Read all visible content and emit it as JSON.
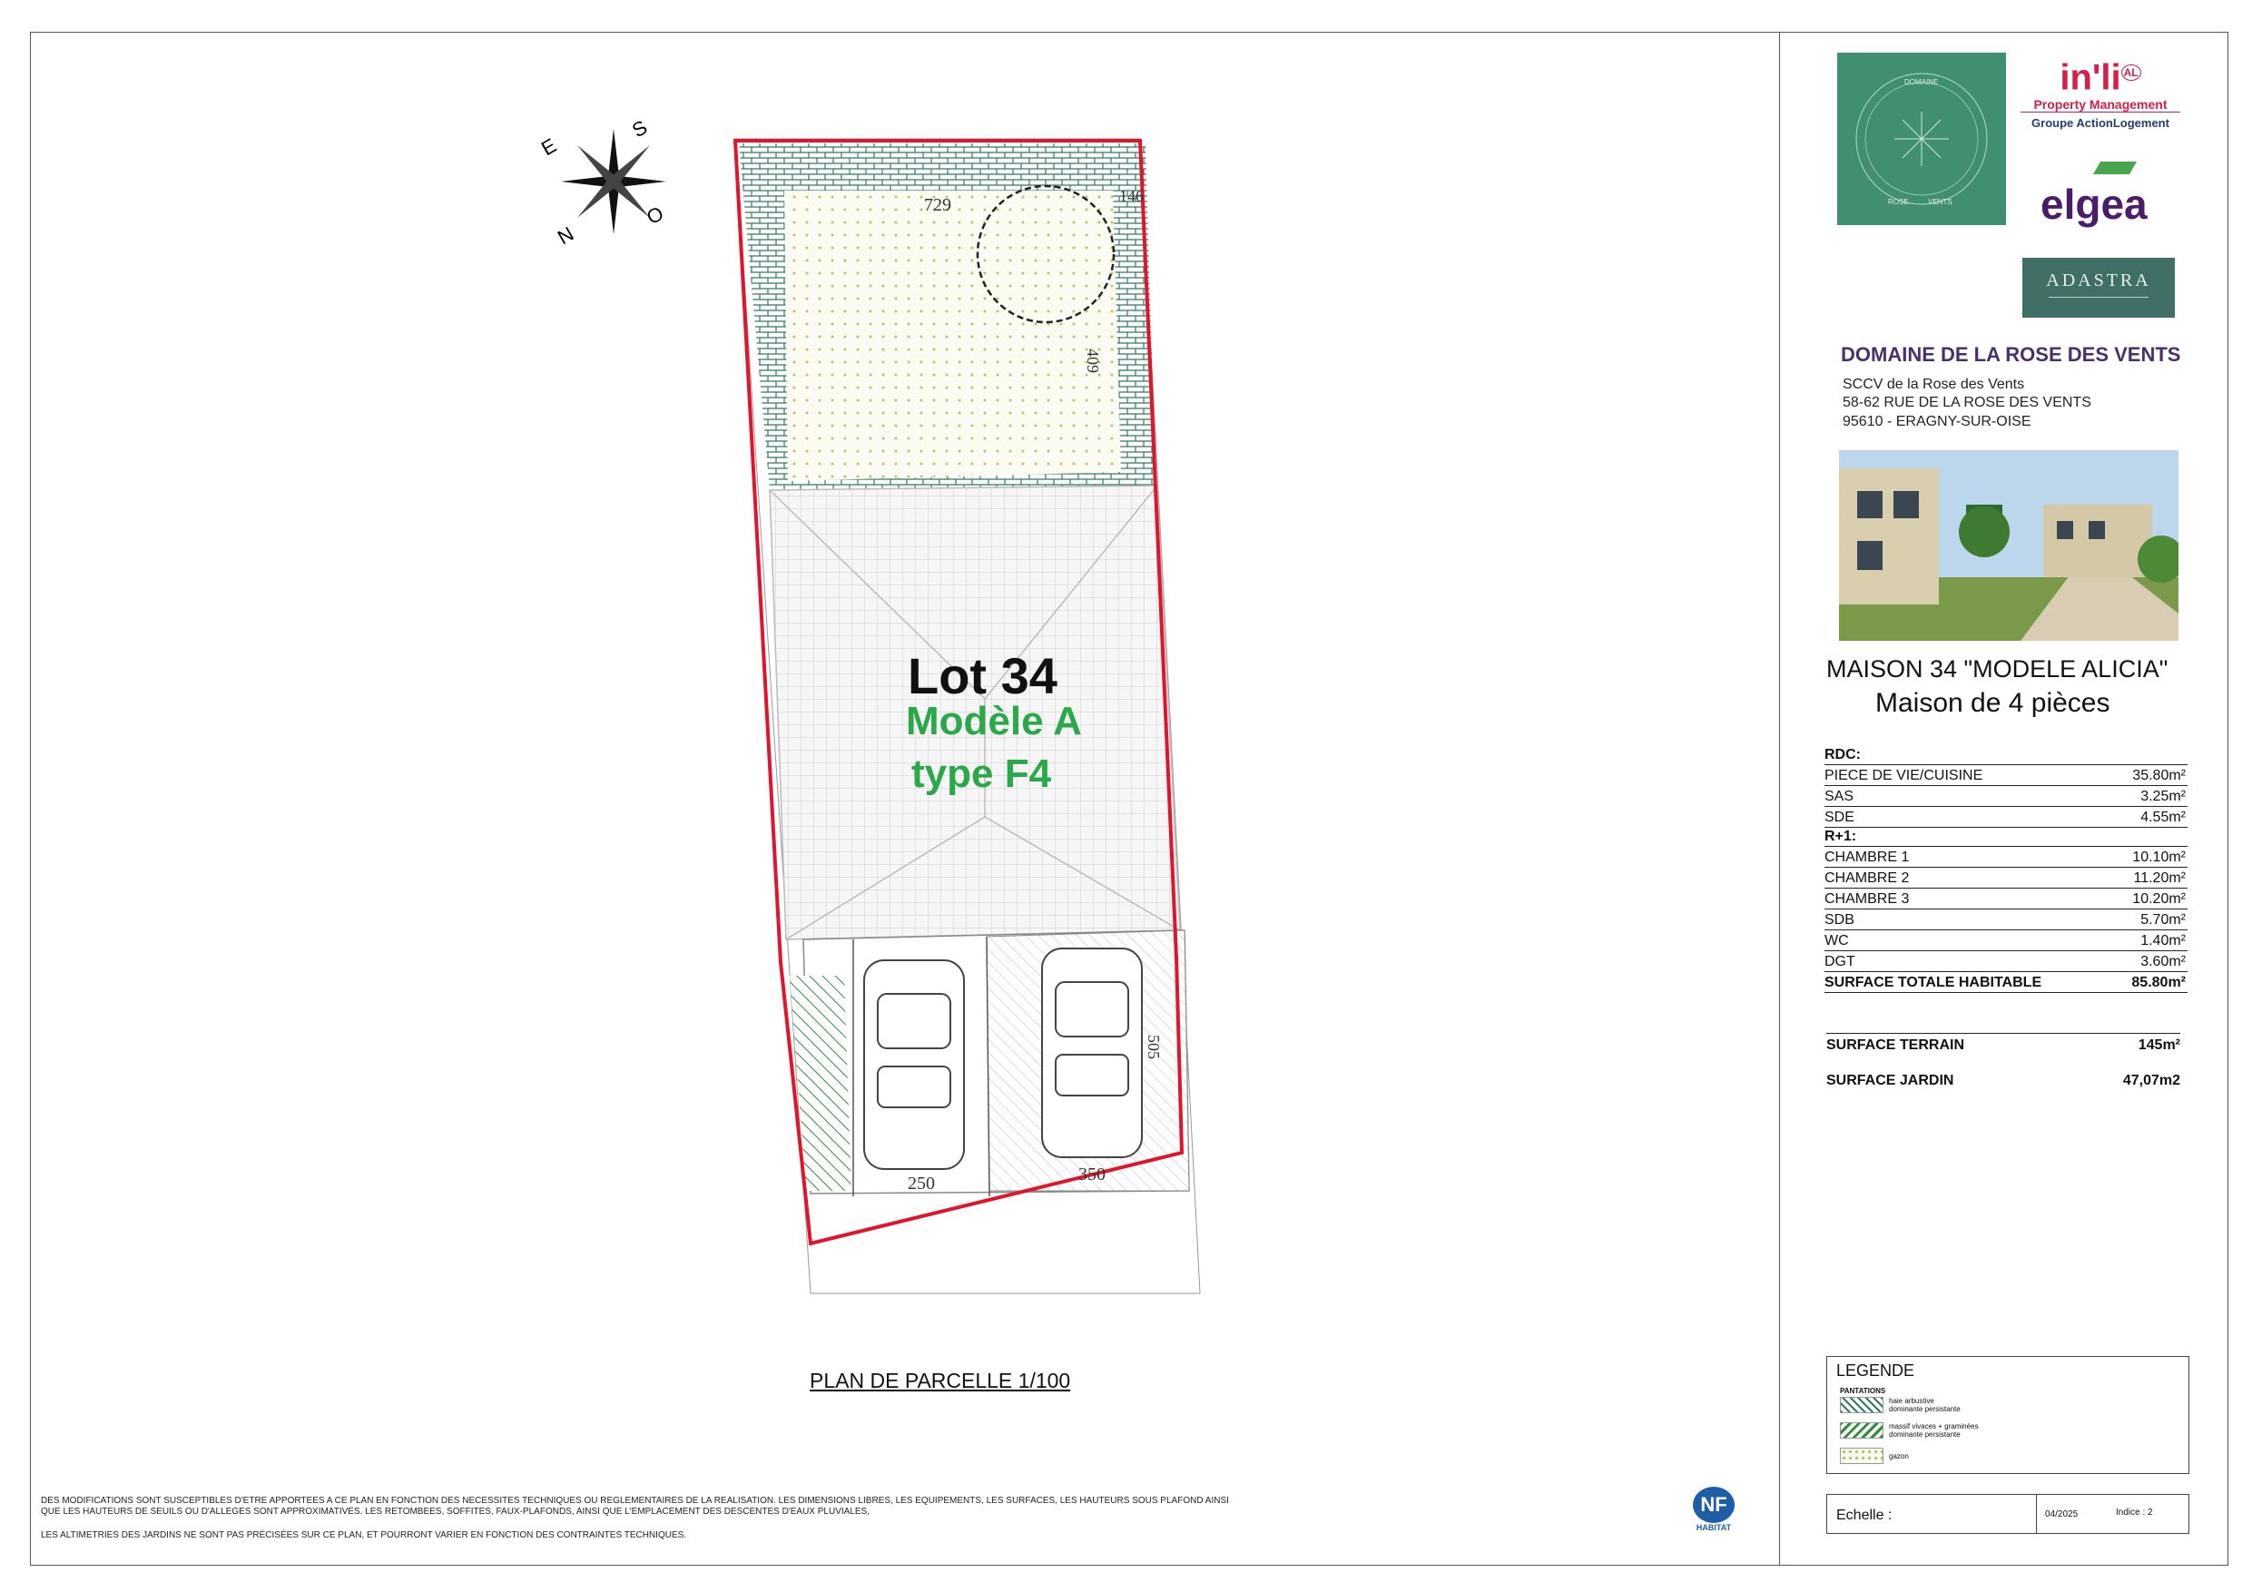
{
  "plan": {
    "lot_title": "Lot 34",
    "model": "Modèle A",
    "type": "type F4",
    "caption": "PLAN DE PARCELLE 1/100",
    "dim_top": "729",
    "dim_corner": "146",
    "dim_right": "409",
    "dim_parking_side": "505",
    "dim_park1": "250",
    "dim_park2": "350"
  },
  "compass": {
    "e": "E",
    "s": "S",
    "o": "O",
    "n": "N"
  },
  "disclaimer": {
    "line1": "DES MODIFICATIONS SONT SUSCEPTIBLES D'ETRE APPORTEES A CE PLAN EN FONCTION DES NECESSITES TECHNIQUES OU REGLEMENTAIRES DE LA REALISATION. LES DIMENSIONS LIBRES, LES EQUIPEMENTS, LES SURFACES, LES HAUTEURS SOUS PLAFOND AINSI",
    "line2": "QUE LES HAUTEURS DE SEUILS OU D'ALLEGES SONT APPROXIMATIVES. LES RETOMBEES, SOFFITES, FAUX-PLAFONDS, AINSI QUE L'EMPLACEMENT DES DESCENTES D'EAUX PLUVIALES,",
    "line3": "LES ALTIMETRIES DES JARDINS NE SONT PAS PRÉCISÉES SUR CE PLAN, ET POURRONT VARIER EN FONCTION DES CONTRAINTES TECHNIQUES."
  },
  "logos": {
    "domaine": "DOMAINE",
    "rose": "ROSE",
    "vents": "VENTS",
    "inli": "in'li",
    "inli_al": "AL",
    "inli_sub": "Property Management",
    "inli_group": "Groupe ActionLogement",
    "elgea": "elgea",
    "adastra": "ADASTRA",
    "nf": "NF",
    "nf_sub": "HABITAT"
  },
  "project": {
    "title": "DOMAINE DE LA ROSE DES VENTS",
    "addr1": "SCCV de la Rose des Vents",
    "addr2": "58-62 RUE DE LA ROSE DES VENTS",
    "addr3": "95610 - ERAGNY-SUR-OISE",
    "maison": "MAISON 34 \"MODELE ALICIA\"",
    "maison_sub": "Maison de 4 pièces"
  },
  "rooms": {
    "rdc_label": "RDC:",
    "rdc": [
      {
        "name": "PIECE DE VIE/CUISINE",
        "area": "35.80m²"
      },
      {
        "name": "SAS",
        "area": "3.25m²"
      },
      {
        "name": "SDE",
        "area": "4.55m²"
      }
    ],
    "r1_label": "R+1:",
    "r1": [
      {
        "name": "CHAMBRE 1",
        "area": "10.10m²"
      },
      {
        "name": "CHAMBRE 2",
        "area": "11.20m²"
      },
      {
        "name": "CHAMBRE 3",
        "area": "10.20m²"
      },
      {
        "name": "SDB",
        "area": "5.70m²"
      },
      {
        "name": "WC",
        "area": "1.40m²"
      },
      {
        "name": "DGT",
        "area": "3.60m²"
      }
    ],
    "total_label": "SURFACE TOTALE HABITABLE",
    "total": "85.80m²"
  },
  "surfaces": {
    "terrain_label": "SURFACE TERRAIN",
    "terrain": "145m²",
    "jardin_label": "SURFACE JARDIN",
    "jardin": "47,07m2"
  },
  "legend": {
    "title": "LEGENDE",
    "subtitle": "PANTATIONS",
    "item1_a": "haie arbustive",
    "item1_b": "dominante persistante",
    "item2_a": "massif vivaces + graminées",
    "item2_b": "dominante persistante",
    "item3": "gazon"
  },
  "echelle": {
    "label": "Echelle :",
    "date": "04/2025",
    "indice": "Indice : 2"
  }
}
